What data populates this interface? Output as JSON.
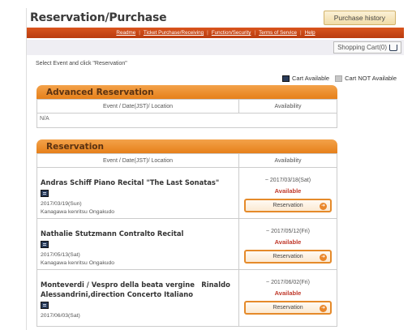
{
  "header": {
    "title": "Reservation/Purchase",
    "history_label": "Purchase history"
  },
  "menu": [
    {
      "label": "Readme"
    },
    {
      "label": "Ticket Purchase/Receiving"
    },
    {
      "label": "Function/Security"
    },
    {
      "label": "Terms of Service"
    },
    {
      "label": "Help"
    }
  ],
  "cart": {
    "label": "Shopping Cart(0)",
    "icon": "cart-icon"
  },
  "instruction": "Select Event and click \"Reservation\"",
  "legend": {
    "available": "Cart Available",
    "not_available": "Cart NOT Available"
  },
  "advanced": {
    "heading": "Advanced Reservation",
    "col_event": "Event / Date(JST)/ Location",
    "col_availability": "Availability",
    "empty_text": "N/A"
  },
  "reservation": {
    "heading": "Reservation",
    "col_event": "Event / Date(JST)/ Location",
    "col_availability": "Availability",
    "events": [
      {
        "name": "Andras Schiff Piano Recital \"The Last Sonatas\"",
        "date": "2017/03/19(Sun)",
        "location": "Kanagawa kenritsu Ongakudo",
        "until": "~ 2017/03/18(Sat)",
        "status": "Available",
        "button": "Reservation"
      },
      {
        "name": "Nathalie Stutzmann Contralto Recital",
        "date": "2017/05/13(Sat)",
        "location": "Kanagawa kenritsu Ongakudo",
        "until": "~ 2017/05/12(Fri)",
        "status": "Available",
        "button": "Reservation"
      },
      {
        "name": "Monteverdi / Vespro della beata vergine　Rinaldo Alessandrini,direction Concerto Italiano",
        "date": "2017/06/03(Sat)",
        "location": "",
        "until": "~ 2017/06/02(Fri)",
        "status": "Available",
        "button": "Reservation"
      }
    ]
  },
  "colors": {
    "accent_orange": "#e6801a",
    "menu_red": "#c4461a",
    "status_red": "#c0392b"
  }
}
